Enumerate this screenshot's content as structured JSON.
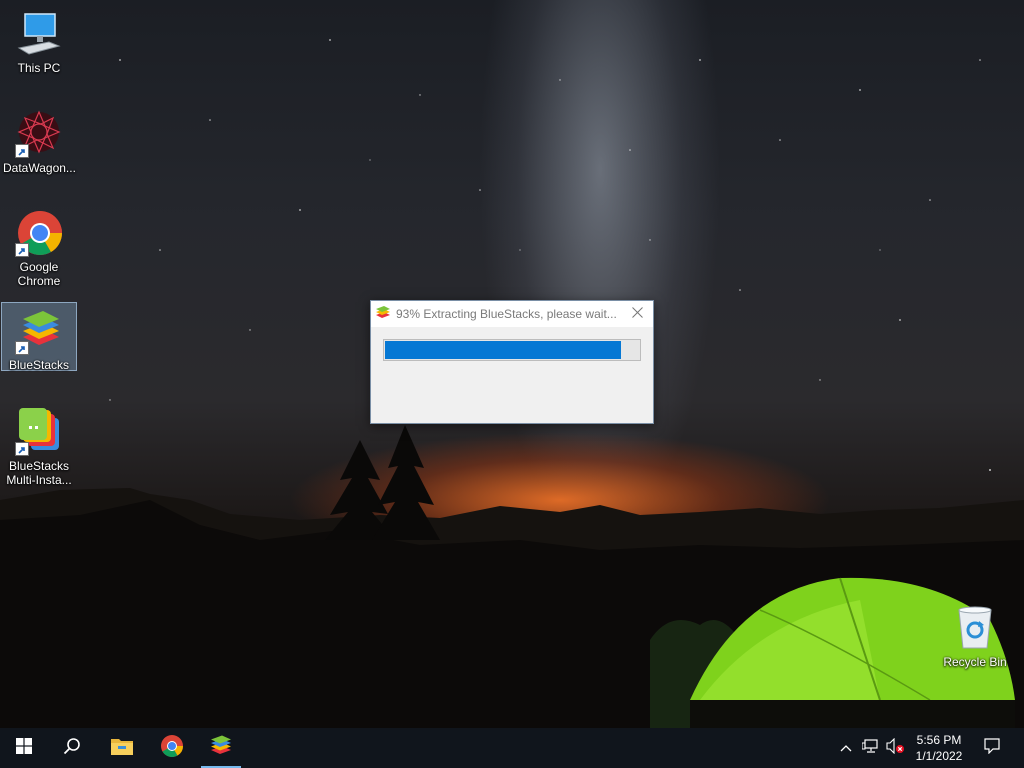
{
  "desktop": {
    "icons": [
      {
        "label": "This PC"
      },
      {
        "label": "DataWagon..."
      },
      {
        "label": "Google Chrome"
      },
      {
        "label": "BlueStacks"
      },
      {
        "label": "BlueStacks Multi-Insta..."
      },
      {
        "label": "Recycle Bin"
      }
    ]
  },
  "dialog": {
    "title": "93% Extracting BlueStacks, please wait...",
    "progress_percent": 93,
    "accent_color": "#0678d4"
  },
  "taskbar": {
    "items": [
      "start-icon",
      "search-icon",
      "file-explorer-icon",
      "chrome-icon",
      "bluestacks-icon"
    ],
    "tray": [
      "chevron-up-icon",
      "network-icon",
      "volume-muted-icon"
    ],
    "clock": {
      "time": "5:56 PM",
      "date": "1/1/2022"
    }
  }
}
